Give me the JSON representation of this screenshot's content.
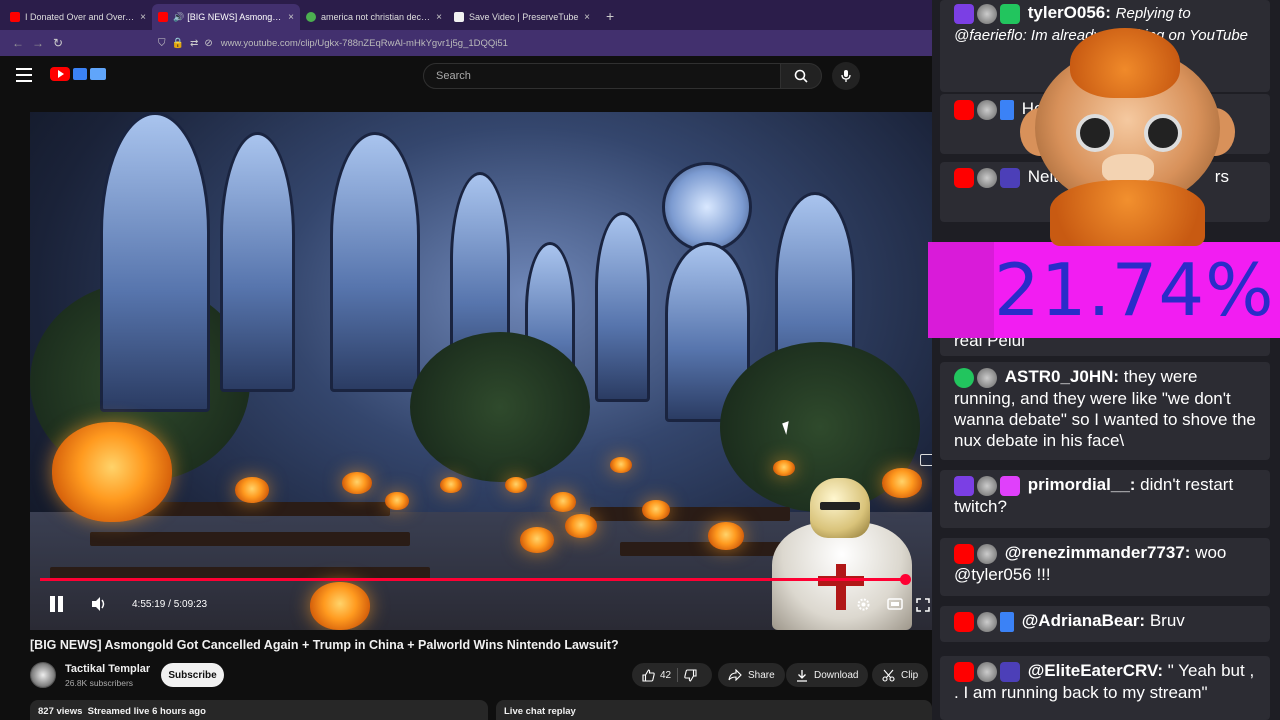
{
  "browser": {
    "tabs": [
      {
        "title": "I Donated Over and Over...To S",
        "active": false,
        "fav_color": "#ff0000"
      },
      {
        "title": "[BIG NEWS] Asmongold Go",
        "active": true,
        "fav_color": "#ff0000"
      },
      {
        "title": "america not christian decarating",
        "active": false,
        "fav_color": "#4caf50"
      },
      {
        "title": "Save Video | PreserveTube",
        "active": false,
        "fav_color": "#f1f1f1"
      }
    ],
    "close_glyph": "×",
    "new_tab_glyph": "+",
    "url": "www.youtube.com/clip/Ugkx-788nZEqRwAl-mHkYgvr1j5g_1DQQi51"
  },
  "youtube": {
    "search_placeholder": "Search",
    "player": {
      "progress": 0.994,
      "time_display": "4:55:19 / 5:09:23"
    },
    "video_title": "[BIG NEWS] Asmongold Got Cancelled Again + Trump in China + Palworld Wins Nintendo Lawsuit?",
    "channel": {
      "name": "Tactikal Templar",
      "subscribers": "26.8K subscribers",
      "subscribe_label": "Subscribe"
    },
    "actions": {
      "like_count": "42",
      "share_label": "Share",
      "download_label": "Download",
      "clip_label": "Clip"
    },
    "description_meta": "827 views  Streamed live 6 hours ago",
    "live_chat_label": "Live chat replay"
  },
  "overlay": {
    "percentage": "21.74%",
    "chat": [
      {
        "who": "tylerO056:",
        "msg": "Replying to @faerieflo: Im already watching on YouTube",
        "italic": true
      },
      {
        "who": "",
        "msg": "Help a Rezzi c",
        "italic": false
      },
      {
        "who": "",
        "msg": "Neither of th                    rs",
        "italic": false
      },
      {
        "who": "",
        "msg": "real Pelui",
        "italic": false
      },
      {
        "who": "ASTR0_J0HN:",
        "msg": "they were running, and they were like \"we don't wanna debate\" so I wanted to shove the nux debate in his face\\",
        "italic": false
      },
      {
        "who": "primordial__:",
        "msg": "didn't restart twitch?",
        "italic": false
      },
      {
        "who": "@renezimmander7737:",
        "msg": "woo @tyler056 !!!",
        "italic": false
      },
      {
        "who": "@AdrianaBear:",
        "msg": "Bruv",
        "italic": false
      },
      {
        "who": "@EliteEaterCRV:",
        "msg": "\" Yeah but , . I am running back to my stream\"",
        "italic": false
      }
    ]
  },
  "colors": {
    "accent": "#ff0033",
    "browser_frame": "#42306e",
    "pct_box": "#f21df2",
    "pct_text": "#2a2cc9"
  }
}
